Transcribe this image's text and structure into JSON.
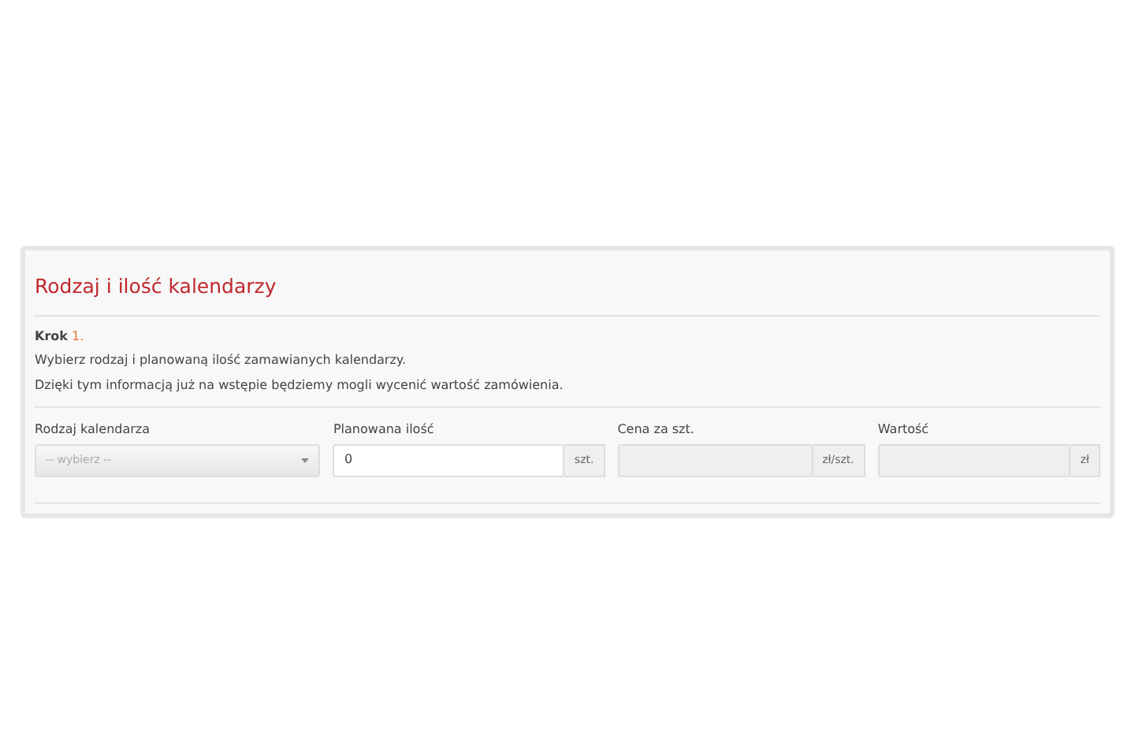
{
  "panel": {
    "title": "Rodzaj i ilość kalendarzy",
    "step_label": "Krok",
    "step_number": "1.",
    "lines": [
      "Wybierz rodzaj i planowaną ilość zamawianych kalendarzy.",
      "Dzięki tym informacją już na wstępie będziemy mogli wycenić wartość zamówienia."
    ],
    "fields": [
      {
        "label": "Rodzaj kalendarza",
        "kind": "select",
        "value": "-- wybierz --",
        "disabled": false
      },
      {
        "label": "Planowana ilość",
        "kind": "input",
        "value": "0",
        "unit": "szt.",
        "disabled": false
      },
      {
        "label": "Cena za szt.",
        "kind": "input",
        "unit": "zł/szt.",
        "disabled": true
      },
      {
        "label": "Wartość",
        "kind": "input",
        "unit": "zł",
        "disabled": true
      }
    ]
  }
}
